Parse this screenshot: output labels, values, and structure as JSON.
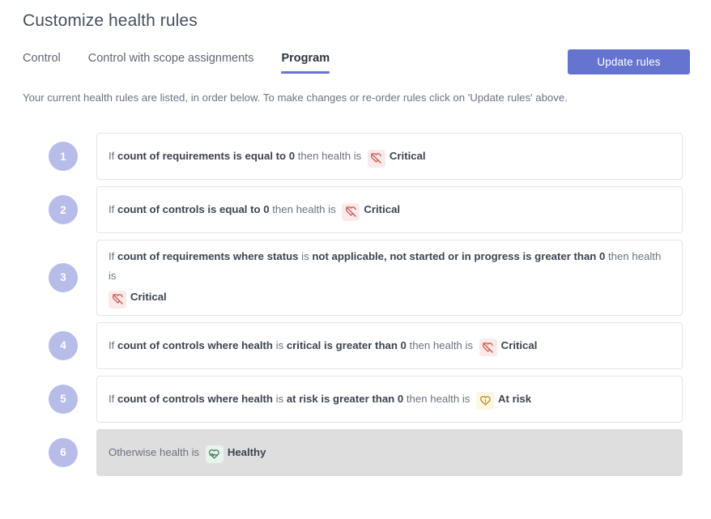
{
  "header": {
    "title": "Customize health rules",
    "update_button_label": "Update rules",
    "intro": "Your current health rules are listed, in order below. To make changes or re-order rules click on 'Update rules' above."
  },
  "tabs": [
    {
      "label": "Control",
      "active": false
    },
    {
      "label": "Control with scope assignments",
      "active": false
    },
    {
      "label": "Program",
      "active": true
    }
  ],
  "colors": {
    "accent": "#6574cf",
    "badge": "#b7bce8",
    "critical_icon": "#c9544a",
    "critical_bg": "#fbeae9",
    "atrisk_icon": "#b08923",
    "atrisk_bg": "#fdf6e3",
    "healthy_icon": "#3f7a5c",
    "healthy_bg": "#e8f3ec",
    "shaded_row_bg": "#dededf",
    "card_border": "#e3e5e9"
  },
  "rules": [
    {
      "number": "1",
      "prefix": "If ",
      "subject": "count of requirements is equal to 0",
      "middle": " then health is ",
      "status_label": "Critical",
      "status_icon": "heart-off-icon",
      "status_kind": "critical",
      "shaded": false,
      "wraps": false
    },
    {
      "number": "2",
      "prefix": "If ",
      "subject": "count of controls is equal to 0",
      "middle": " then health is ",
      "status_label": "Critical",
      "status_icon": "heart-off-icon",
      "status_kind": "critical",
      "shaded": false,
      "wraps": false
    },
    {
      "number": "3",
      "prefix": "If ",
      "subject": "count of requirements where status",
      "connector": " is ",
      "condition": "not applicable, not started or in progress is greater than 0",
      "middle": " then health is",
      "status_label": "Critical",
      "status_icon": "heart-off-icon",
      "status_kind": "critical",
      "shaded": false,
      "wraps": true
    },
    {
      "number": "4",
      "prefix": "If ",
      "subject": "count of controls where health",
      "connector": " is ",
      "condition": "critical is greater than 0",
      "middle": " then health is ",
      "status_label": "Critical",
      "status_icon": "heart-off-icon",
      "status_kind": "critical",
      "shaded": false,
      "wraps": false
    },
    {
      "number": "5",
      "prefix": "If ",
      "subject": "count of controls where health",
      "connector": " is ",
      "condition": "at risk is greater than 0",
      "middle": " then health is ",
      "status_label": "At risk",
      "status_icon": "heart-alert-icon",
      "status_kind": "atrisk",
      "shaded": false,
      "wraps": false
    },
    {
      "number": "6",
      "prefix": "Otherwise health is ",
      "status_label": "Healthy",
      "status_icon": "heart-pulse-icon",
      "status_kind": "healthy",
      "shaded": true,
      "wraps": false
    }
  ]
}
